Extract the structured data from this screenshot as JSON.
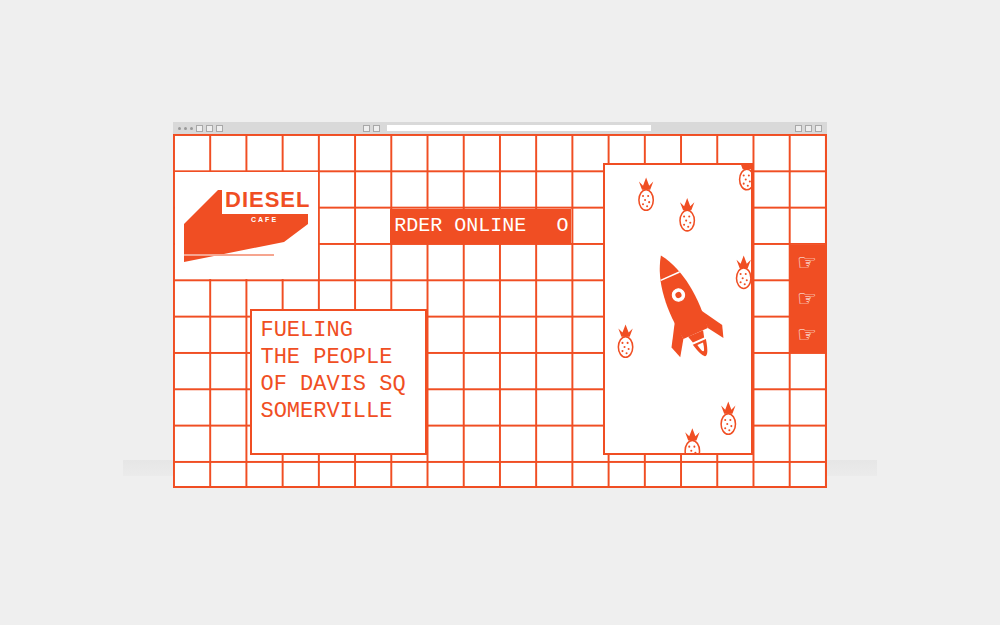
{
  "logo": {
    "wordmark": "DIESEL",
    "sub": "CAFE"
  },
  "banner": {
    "text": "RDER ONLINE",
    "next": "O"
  },
  "headline": {
    "lines": [
      "FUELING",
      "THE PEOPLE",
      "OF DAVIS SQ",
      "SOMERVILLE"
    ]
  },
  "side_tab": {
    "items": [
      {
        "icon": "☞"
      },
      {
        "icon": "☞"
      },
      {
        "icon": "☞"
      }
    ]
  }
}
